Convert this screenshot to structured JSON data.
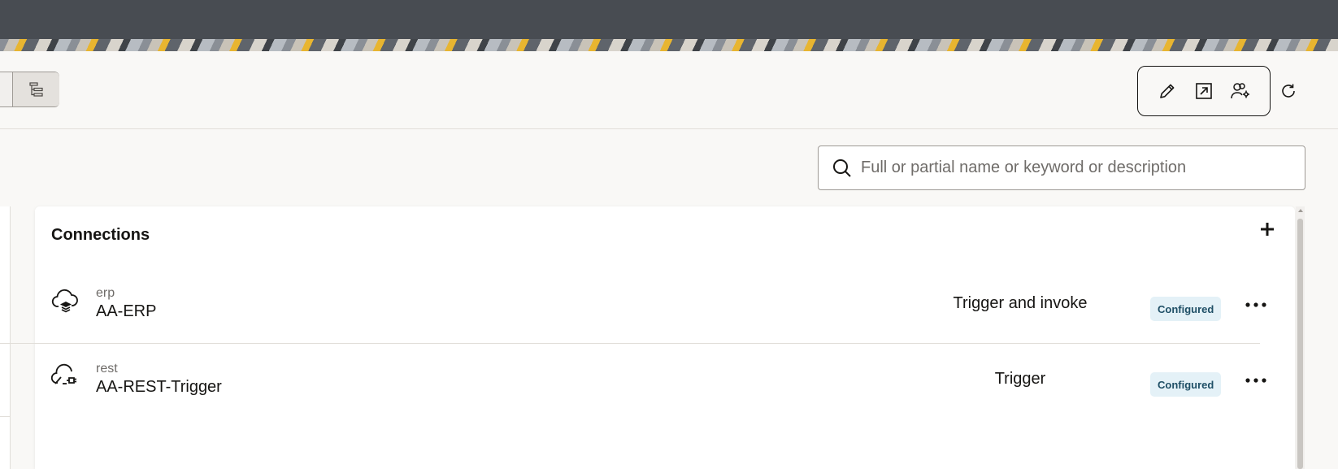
{
  "toolbar": {
    "actions": [
      {
        "icon": "pencil-icon",
        "label": "Edit"
      },
      {
        "icon": "export-icon",
        "label": "Open in new window"
      },
      {
        "icon": "users-settings-icon",
        "label": "Access"
      }
    ],
    "refresh_icon": "refresh-icon"
  },
  "search": {
    "placeholder": "Full or partial name or keyword or description",
    "value": ""
  },
  "connections": {
    "title": "Connections",
    "rows": [
      {
        "type": "erp",
        "name": "AA-ERP",
        "role": "Trigger and invoke",
        "status": "Configured",
        "icon": "cloud-erp-icon"
      },
      {
        "type": "rest",
        "name": "AA-REST-Trigger",
        "role": "Trigger",
        "status": "Configured",
        "icon": "cloud-rest-icon"
      }
    ]
  },
  "colors": {
    "topbar": "#484c52",
    "badge_bg": "#e4f1f7",
    "badge_text": "#1f4f66"
  }
}
